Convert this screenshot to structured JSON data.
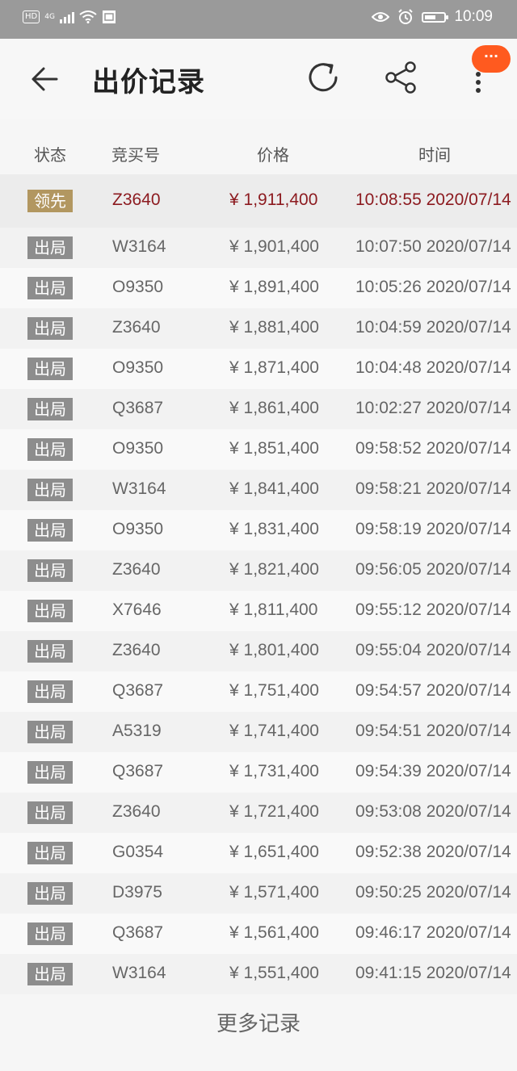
{
  "status_bar": {
    "hd": "HD",
    "network": "4G",
    "time": "10:09"
  },
  "app_bar": {
    "title": "出价记录",
    "float_badge": "···"
  },
  "table": {
    "headers": {
      "status": "状态",
      "code": "竞买号",
      "price": "价格",
      "time": "时间"
    },
    "rows": [
      {
        "status": "领先",
        "code": "Z3640",
        "price": "¥ 1,911,400",
        "time": "10:08:55 2020/07/14",
        "leader": true
      },
      {
        "status": "出局",
        "code": "W3164",
        "price": "¥ 1,901,400",
        "time": "10:07:50 2020/07/14"
      },
      {
        "status": "出局",
        "code": "O9350",
        "price": "¥ 1,891,400",
        "time": "10:05:26 2020/07/14"
      },
      {
        "status": "出局",
        "code": "Z3640",
        "price": "¥ 1,881,400",
        "time": "10:04:59 2020/07/14"
      },
      {
        "status": "出局",
        "code": "O9350",
        "price": "¥ 1,871,400",
        "time": "10:04:48 2020/07/14"
      },
      {
        "status": "出局",
        "code": "Q3687",
        "price": "¥ 1,861,400",
        "time": "10:02:27 2020/07/14"
      },
      {
        "status": "出局",
        "code": "O9350",
        "price": "¥ 1,851,400",
        "time": "09:58:52 2020/07/14"
      },
      {
        "status": "出局",
        "code": "W3164",
        "price": "¥ 1,841,400",
        "time": "09:58:21 2020/07/14"
      },
      {
        "status": "出局",
        "code": "O9350",
        "price": "¥ 1,831,400",
        "time": "09:58:19 2020/07/14"
      },
      {
        "status": "出局",
        "code": "Z3640",
        "price": "¥ 1,821,400",
        "time": "09:56:05 2020/07/14"
      },
      {
        "status": "出局",
        "code": "X7646",
        "price": "¥ 1,811,400",
        "time": "09:55:12 2020/07/14"
      },
      {
        "status": "出局",
        "code": "Z3640",
        "price": "¥ 1,801,400",
        "time": "09:55:04 2020/07/14"
      },
      {
        "status": "出局",
        "code": "Q3687",
        "price": "¥ 1,751,400",
        "time": "09:54:57 2020/07/14"
      },
      {
        "status": "出局",
        "code": "A5319",
        "price": "¥ 1,741,400",
        "time": "09:54:51 2020/07/14"
      },
      {
        "status": "出局",
        "code": "Q3687",
        "price": "¥ 1,731,400",
        "time": "09:54:39 2020/07/14"
      },
      {
        "status": "出局",
        "code": "Z3640",
        "price": "¥ 1,721,400",
        "time": "09:53:08 2020/07/14"
      },
      {
        "status": "出局",
        "code": "G0354",
        "price": "¥ 1,651,400",
        "time": "09:52:38 2020/07/14"
      },
      {
        "status": "出局",
        "code": "D3975",
        "price": "¥ 1,571,400",
        "time": "09:50:25 2020/07/14"
      },
      {
        "status": "出局",
        "code": "Q3687",
        "price": "¥ 1,561,400",
        "time": "09:46:17 2020/07/14"
      },
      {
        "status": "出局",
        "code": "W3164",
        "price": "¥ 1,551,400",
        "time": "09:41:15 2020/07/14"
      }
    ]
  },
  "more_records": "更多记录",
  "colors": {
    "leader_badge": "#b29760",
    "out_badge": "#8d8d8d",
    "leader_text": "#8c1a1f",
    "float_badge": "#ff5a1f"
  }
}
